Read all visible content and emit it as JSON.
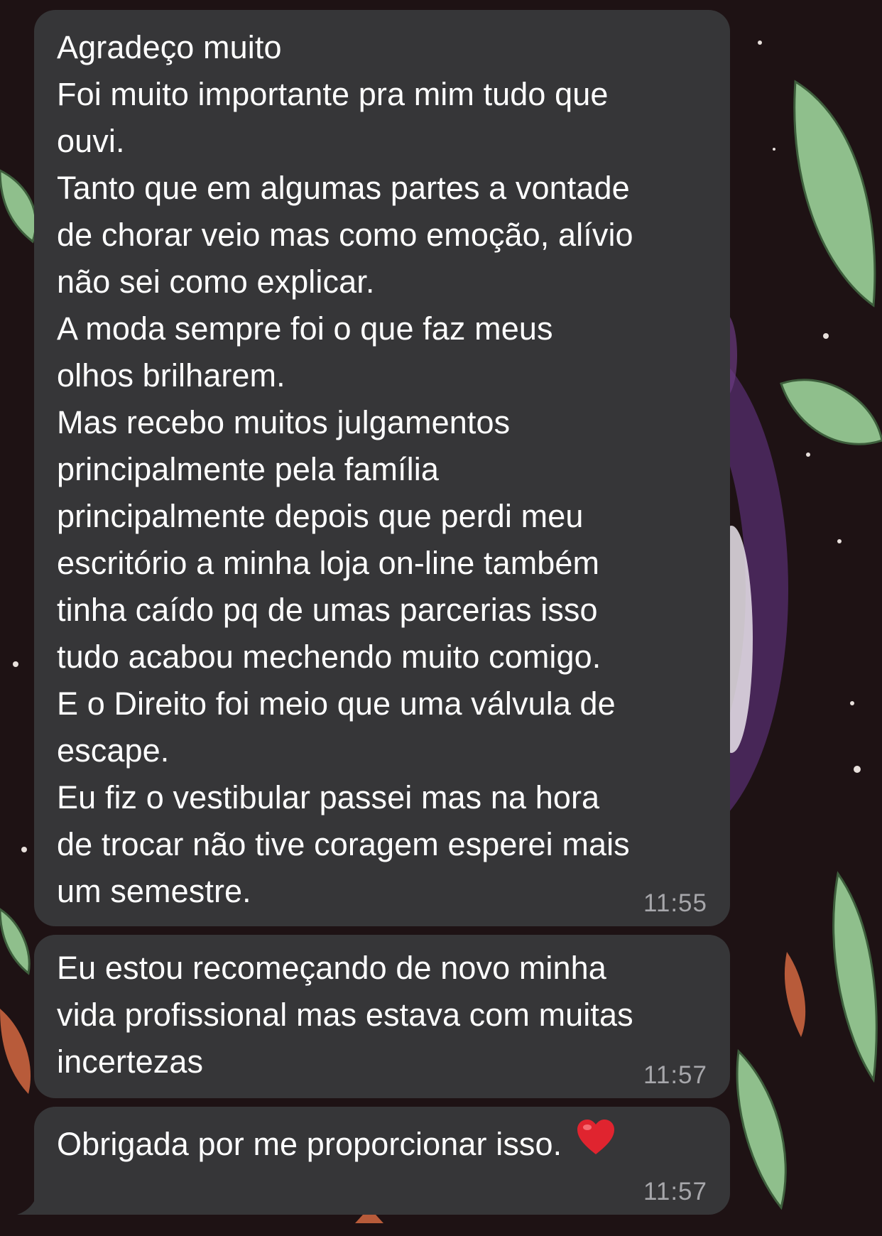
{
  "messages": [
    {
      "text": "Agradeço muito\nFoi muito importante pra mim tudo que\nouvi.\nTanto que em algumas partes a vontade\nde chorar veio mas como emoção, alívio\nnão sei como explicar.\nA moda sempre foi o que faz meus\nolhos brilharem.\nMas recebo muitos julgamentos\nprincipalmente pela família\nprincipalmente depois que perdi meu\nescritório a minha loja on-line também\ntinha caído pq de umas parcerias isso\ntudo acabou mechendo muito comigo.\nE o Direito foi meio que uma válvula de\nescape.\nEu fiz o vestibular passei mas na hora\nde trocar não tive coragem esperei mais\num semestre.",
      "time": "11:55"
    },
    {
      "text": "Eu estou recomeçando de novo minha\nvida profissional mas estava com muitas\nincertezas",
      "time": "11:57"
    },
    {
      "text": "Obrigada por me proporcionar isso.",
      "emoji": "heart-emoji",
      "time": "11:57"
    }
  ],
  "colors": {
    "bubble": "#363638",
    "text": "#ffffff",
    "timestamp": "#a7a7ab",
    "heart": "#e0242f",
    "leaf": "#8fbf8c",
    "wallpaper": "#1e1214"
  }
}
